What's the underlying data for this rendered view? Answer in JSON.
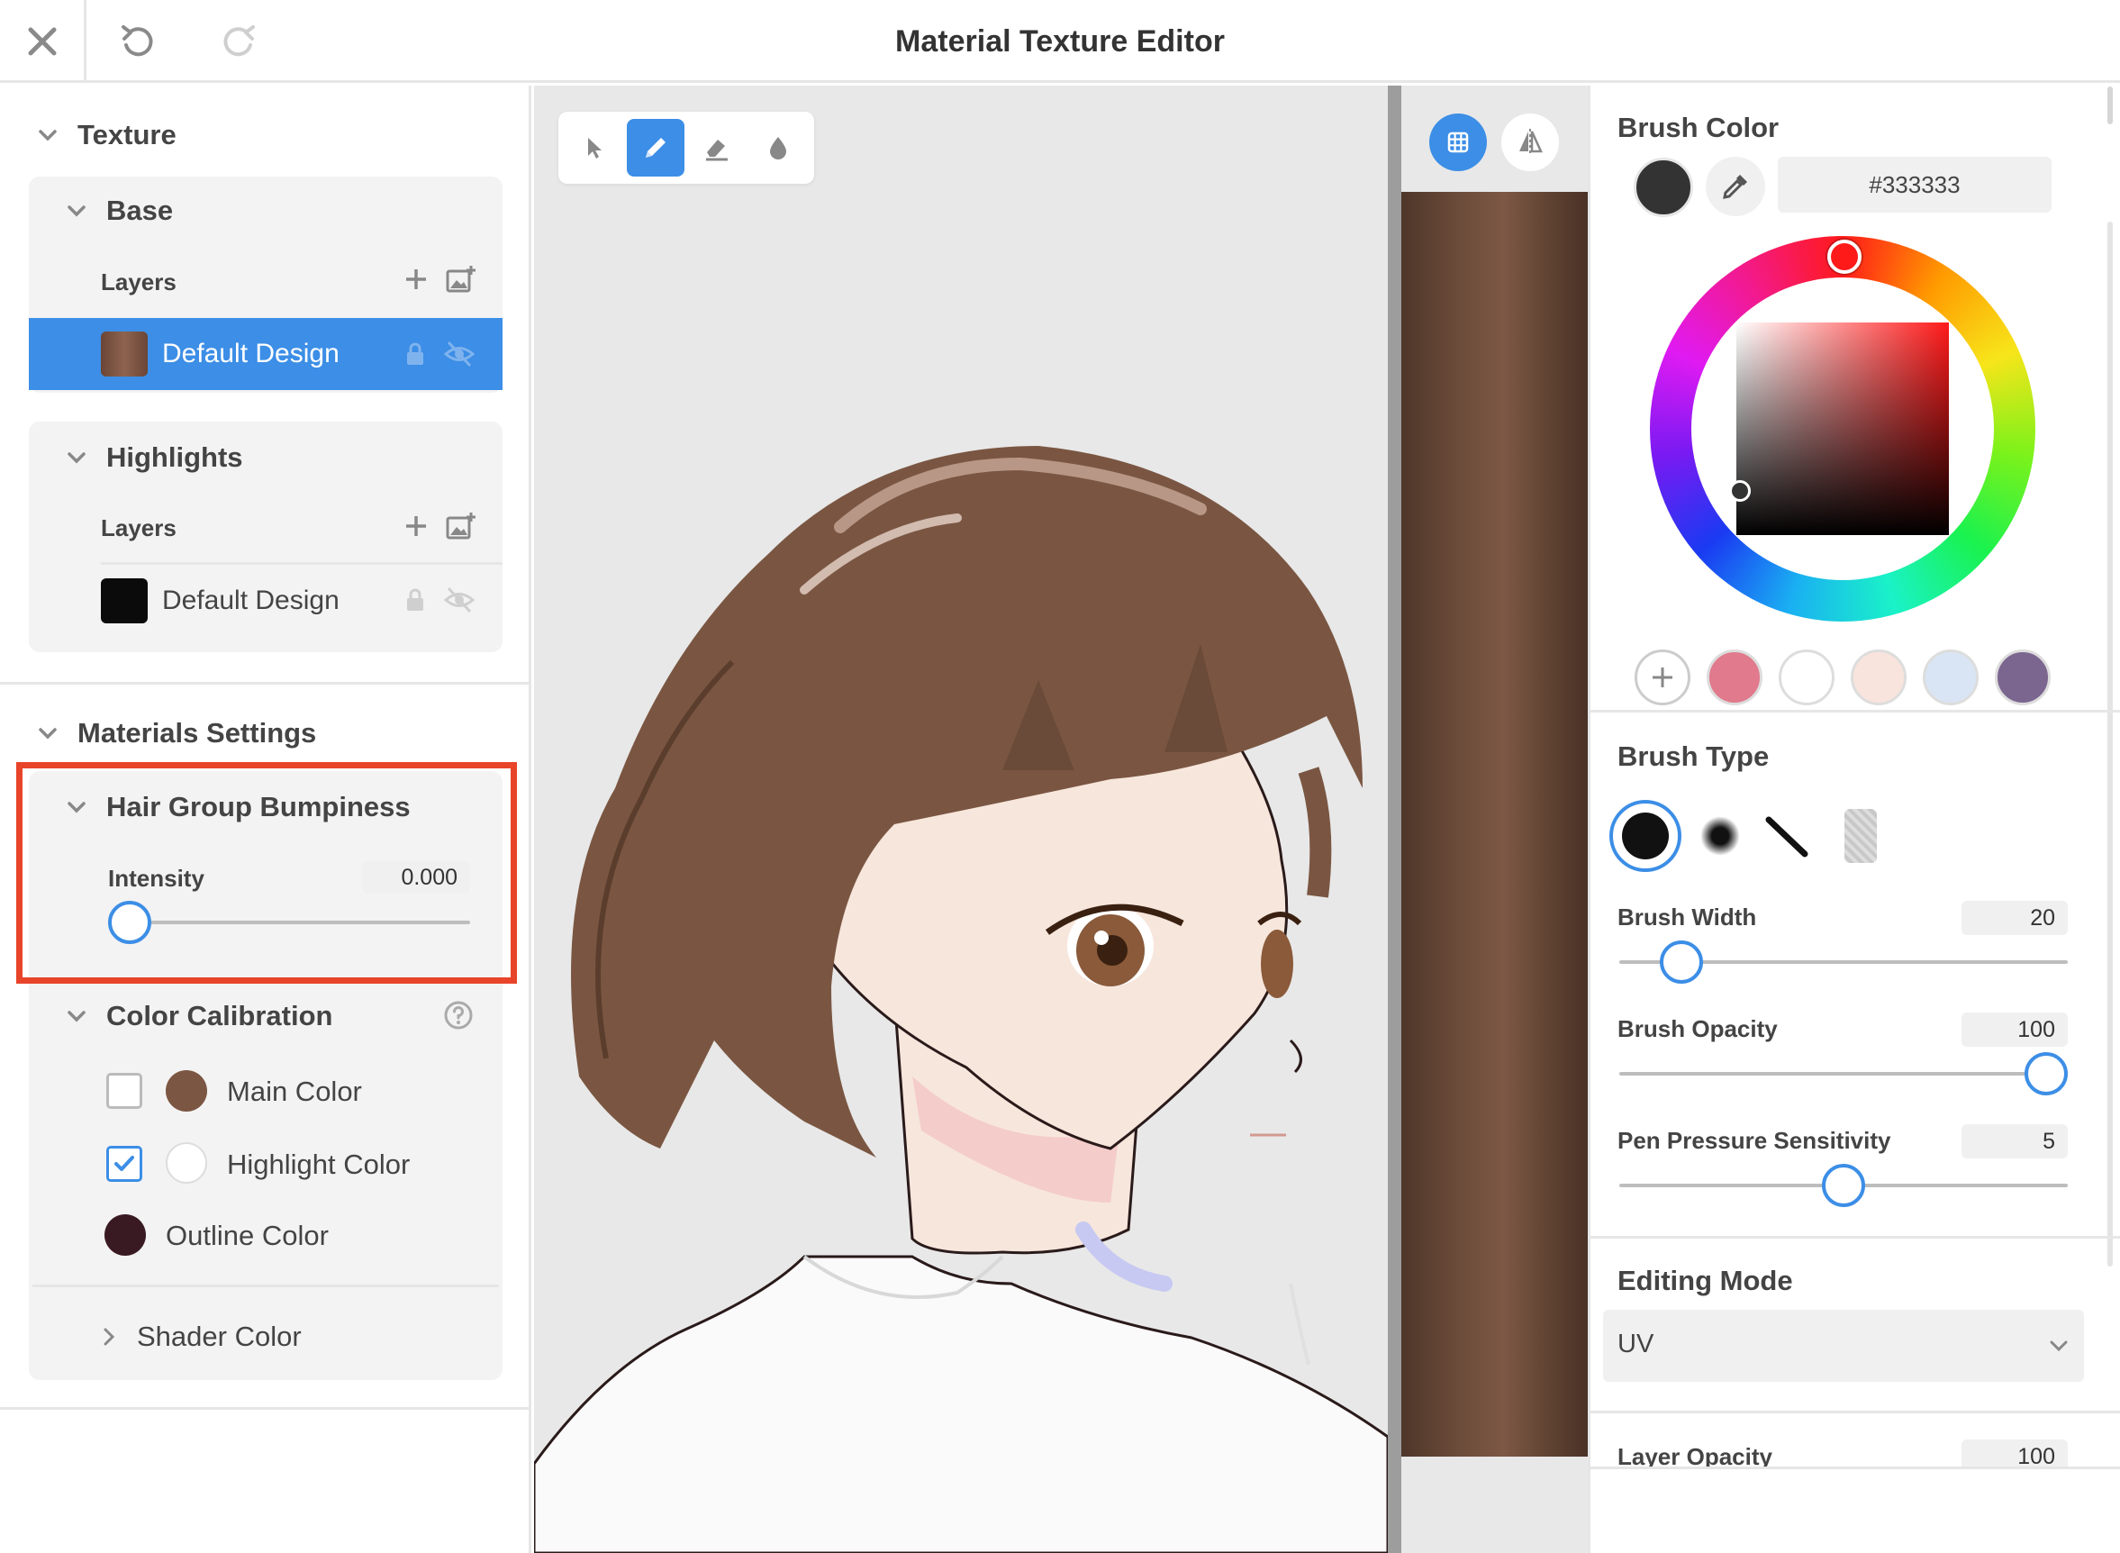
{
  "app": {
    "title": "Material Texture Editor"
  },
  "left_panel": {
    "texture_header": "Texture",
    "base": {
      "title": "Base",
      "layers_label": "Layers",
      "layer_name": "Default Design"
    },
    "highlights": {
      "title": "Highlights",
      "layers_label": "Layers",
      "layer_name": "Default Design"
    },
    "materials_header": "Materials Settings",
    "hair_bumpiness": {
      "title": "Hair Group Bumpiness",
      "intensity_label": "Intensity",
      "intensity_value": "0.000",
      "intensity_fraction": 0.0
    },
    "color_calibration": {
      "title": "Color Calibration",
      "items": [
        {
          "label": "Main Color",
          "checked": false,
          "color": "#7b5642"
        },
        {
          "label": "Highlight Color",
          "checked": true,
          "color": "#ffffff"
        },
        {
          "label": "Outline Color",
          "color": "#3a1a22"
        }
      ],
      "shader_color": "Shader Color"
    }
  },
  "toolbox": {
    "tools": [
      "select-arrow-icon",
      "pencil-icon",
      "eraser-icon",
      "fill-drop-icon"
    ],
    "active": "pencil-icon"
  },
  "right_panel": {
    "brush_color": {
      "title": "Brush Color",
      "hex": "#333333",
      "current": "#333333"
    },
    "palette": [
      "#e07a8c",
      "#ffffff",
      "#f8e4dc",
      "#d9e5f4",
      "#7b6690"
    ],
    "brush_type": {
      "title": "Brush Type"
    },
    "brush_width": {
      "label": "Brush Width",
      "value": "20",
      "fraction": 0.1
    },
    "brush_opacity": {
      "label": "Brush Opacity",
      "value": "100",
      "fraction": 1.0
    },
    "pen_pressure": {
      "label": "Pen Pressure Sensitivity",
      "value": "5",
      "fraction": 0.5
    },
    "editing_mode": {
      "title": "Editing Mode",
      "value": "UV"
    },
    "layer_opacity": {
      "label": "Layer Opacity",
      "value": "100"
    }
  },
  "colors": {
    "accent": "#3c8ee6",
    "highlight_box": "#e8442a",
    "hair": "#7a5642",
    "skin": "#f7e6dc"
  }
}
